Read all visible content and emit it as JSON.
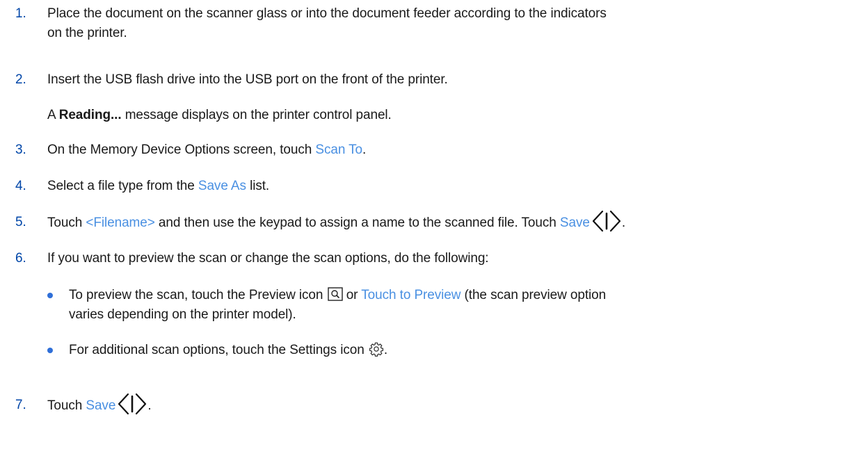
{
  "steps": [
    {
      "number": "1.",
      "line1": "Place the document on the scanner glass or into the document feeder according to the indicators",
      "line2": "on the printer."
    },
    {
      "number": "2.",
      "text": "Insert the USB flash drive into the USB port on the front of the printer.",
      "note_prefix": "A",
      "note_bold": "Reading...",
      "note_suffix": "message displays on the printer control panel."
    },
    {
      "number": "3.",
      "text_before": "On the Memory Device Options screen, touch",
      "link": "Scan To",
      "text_after": "."
    },
    {
      "number": "4.",
      "text_before": "Select a file type from the",
      "link": "Save As",
      "text_after": "list."
    },
    {
      "number": "5.",
      "text_before": "Touch",
      "link1": "<Filename>",
      "text_middle": "and then use the keypad to assign a name to the scanned file. Touch",
      "link2": "Save",
      "text_after": "."
    },
    {
      "number": "6.",
      "text": "If you want to preview the scan or change the scan options, do the following:",
      "bullets": [
        {
          "text_before": "To preview the scan, touch the Preview icon",
          "text_or": "or",
          "link": "Touch to Preview",
          "text_after": "(the scan preview option",
          "line2": "varies depending on the printer model)."
        },
        {
          "text_before": "For additional scan options, touch the Settings icon",
          "text_after": "."
        }
      ]
    },
    {
      "number": "7.",
      "text_before": "Touch",
      "link": "Save",
      "text_after": "."
    }
  ],
  "icons": {
    "start": "start-icon",
    "preview": "preview-icon",
    "settings": "gear-icon"
  },
  "colors": {
    "number": "#0046a8",
    "link": "#4a90e2",
    "bullet": "#2f6fd8",
    "text": "#1a1a1a"
  }
}
